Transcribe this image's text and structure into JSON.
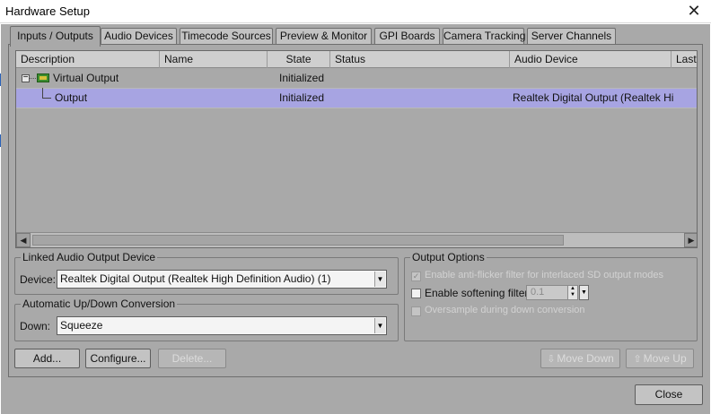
{
  "window": {
    "title": "Hardware Setup",
    "close_glyph": "✕"
  },
  "tabs": [
    {
      "label": "Inputs / Outputs",
      "active": true
    },
    {
      "label": "Audio Devices"
    },
    {
      "label": "Timecode Sources"
    },
    {
      "label": "Preview & Monitor"
    },
    {
      "label": "GPI Boards"
    },
    {
      "label": "Camera Tracking"
    },
    {
      "label": "Server Channels"
    }
  ],
  "grid": {
    "columns": [
      "Description",
      "Name",
      "State",
      "Status",
      "Audio Device",
      "Last"
    ],
    "rows": [
      {
        "description": "Virtual Output",
        "name": "",
        "state": "Initialized",
        "status": "",
        "audio_device": "",
        "expander": "−",
        "icon": "board-icon"
      },
      {
        "description": "Output",
        "name": "",
        "state": "Initialized",
        "status": "",
        "audio_device": "Realtek Digital Output (Realtek Hi...",
        "selected": true
      }
    ],
    "scroll_left_glyph": "◀",
    "scroll_right_glyph": "▶"
  },
  "linked_audio": {
    "legend": "Linked Audio Output Device",
    "device_label": "Device:",
    "device_value": "Realtek Digital Output (Realtek High Definition Audio) (1)"
  },
  "conversion": {
    "legend": "Automatic Up/Down Conversion",
    "down_label": "Down:",
    "down_value": "Squeeze"
  },
  "output_options": {
    "legend": "Output Options",
    "anti_flicker": {
      "label": "Enable anti-flicker filter for interlaced SD output modes",
      "checked": true,
      "enabled": false,
      "glyph": "✓"
    },
    "softening": {
      "label": "Enable softening filter",
      "checked": false,
      "enabled": true,
      "value": "0.1"
    },
    "oversample": {
      "label": "Oversample during down conversion",
      "checked": false,
      "enabled": false
    }
  },
  "buttons": {
    "add": "Add...",
    "configure": "Configure...",
    "delete": "Delete...",
    "move_down": "Move Down",
    "move_up": "Move Up",
    "close": "Close"
  },
  "glyphs": {
    "dropdown": "▼",
    "spin_up": "▲",
    "spin_down": "▼",
    "move_down_icon": "⇩",
    "move_up_icon": "⇧"
  }
}
